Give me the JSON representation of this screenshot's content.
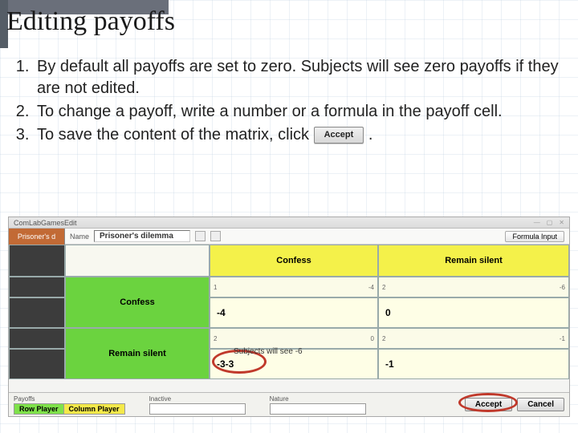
{
  "slide": {
    "title": "Editing payoffs",
    "items": [
      "By default all payoffs are set to zero. Subjects will see zero payoffs if they are not edited.",
      "To change a payoff, write a number or a formula in the payoff cell.",
      "To save the  content of the matrix, click "
    ],
    "accept_inline_label": "Accept",
    "period_after": "."
  },
  "app": {
    "window_title": "ComLabGamesEdit",
    "left_tab": "Prisoner's d",
    "name_label": "Name",
    "name_value": "Prisoner's dilemma",
    "formula_button": "Formula Input",
    "col_headers": [
      "Confess",
      "Remain silent"
    ],
    "row_headers": [
      "Confess",
      "Remain silent"
    ],
    "sub_indices": {
      "r1c1": "1",
      "r1c2": "2",
      "r2c1": "2",
      "r2c2": "2"
    },
    "cells": {
      "r1c1_left": "-4",
      "r1c1_right": "-4",
      "r1c2_left": "0",
      "r1c2_right": "-6",
      "r2c1_left": "-3-3",
      "r2c1_right": "0",
      "r2c2_left": "-1",
      "r2c2_right": "-1"
    },
    "annotation": "Subjects will see -6",
    "footer": {
      "payoffs_label": "Payoffs",
      "row_player": "Row Player",
      "column_player": "Column Player",
      "inactive_label": "Inactive",
      "nature_label": "Nature",
      "accept": "Accept",
      "cancel": "Cancel"
    }
  }
}
